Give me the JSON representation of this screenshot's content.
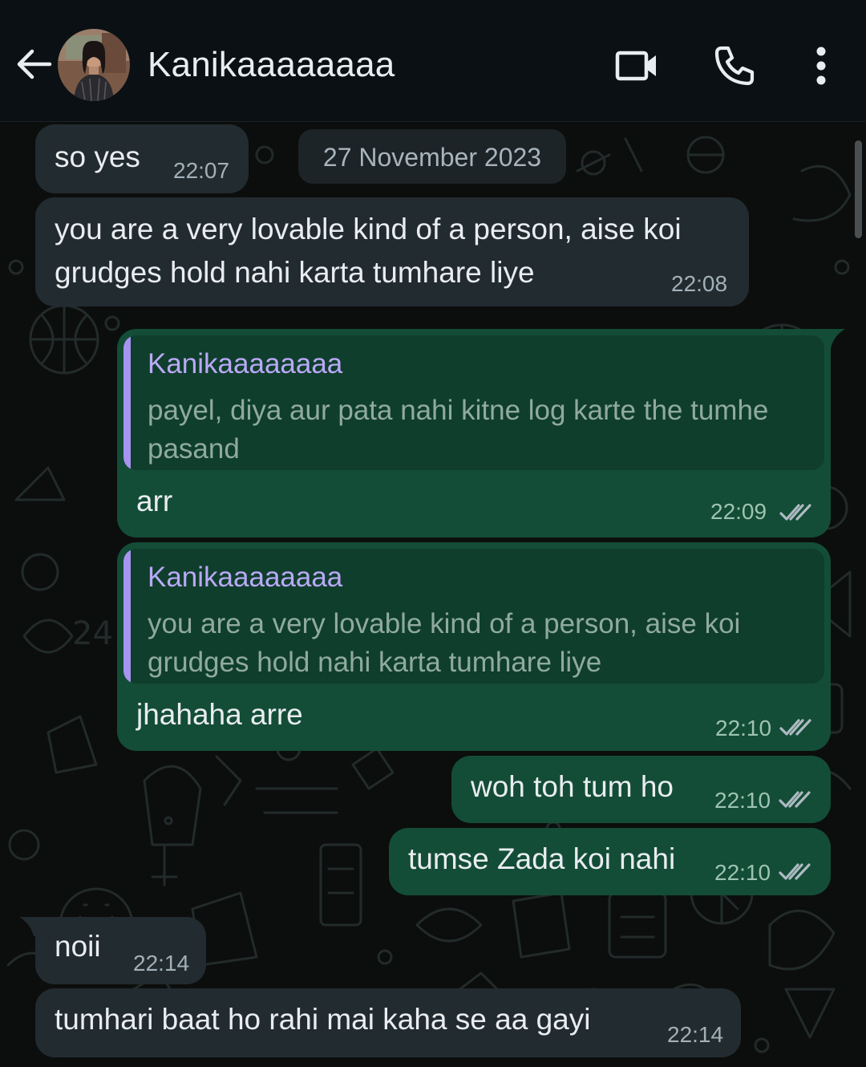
{
  "header": {
    "contact_name": "Kanikaaaaaaaa",
    "back_icon": "arrow-left-icon",
    "video_icon": "video-camera-icon",
    "call_icon": "phone-icon",
    "menu_icon": "more-vertical-icon"
  },
  "chat": {
    "date_chip": "27 November 2023",
    "messages": [
      {
        "direction": "incoming",
        "text": "so yes",
        "time": "22:07"
      },
      {
        "direction": "incoming",
        "text_lines": [
          "you are a very lovable kind of a person, aise koi",
          "grudges hold nahi karta tumhare liye"
        ],
        "time": "22:08"
      },
      {
        "direction": "outgoing",
        "reply_to": {
          "author": "Kanikaaaaaaaa",
          "lines": [
            "payel, diya aur pata nahi kitne log karte the tumhe",
            "pasand"
          ]
        },
        "text": "arr",
        "time": "22:09",
        "status": "read"
      },
      {
        "direction": "outgoing",
        "reply_to": {
          "author": "Kanikaaaaaaaa",
          "lines": [
            "you are a very lovable kind of a person, aise koi",
            "grudges hold nahi karta tumhare liye"
          ]
        },
        "text": "jhahaha arre",
        "time": "22:10",
        "status": "read"
      },
      {
        "direction": "outgoing",
        "text": "woh toh tum ho",
        "time": "22:10",
        "status": "read"
      },
      {
        "direction": "outgoing",
        "text": "tumse Zada koi nahi",
        "time": "22:10",
        "status": "read"
      },
      {
        "direction": "incoming",
        "text": "noii",
        "time": "22:14"
      },
      {
        "direction": "incoming",
        "text": "tumhari baat ho rahi mai kaha se aa gayi",
        "time": "22:14"
      }
    ]
  },
  "colors": {
    "header_bg": "#0b1014",
    "chat_bg": "#0b0e0d",
    "incoming_bubble": "#222b30",
    "outgoing_bubble": "#134d37",
    "quote_bg": "#0f3e2d",
    "quote_accent": "#a694f0",
    "tick_color": "#aebac1"
  }
}
